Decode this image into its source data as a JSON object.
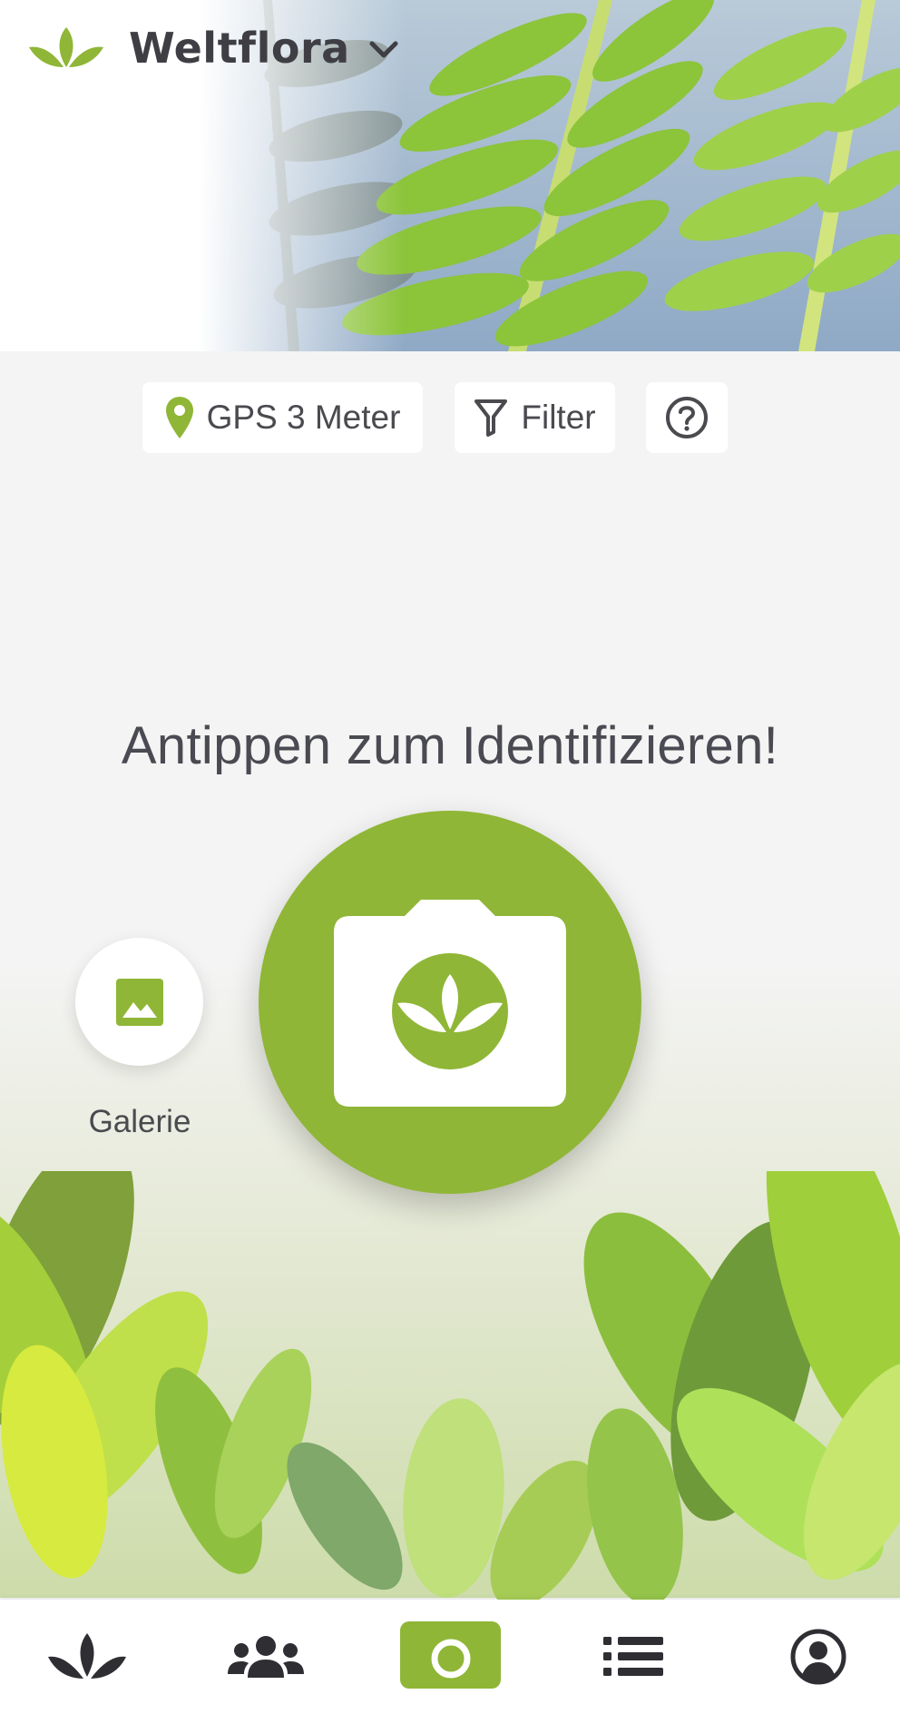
{
  "app": {
    "flora_selector": "Weltflora"
  },
  "toolbar": {
    "gps_label": "GPS 3 Meter",
    "filter_label": "Filter"
  },
  "main": {
    "prompt": "Antippen zum Identifizieren!",
    "gallery_label": "Galerie"
  },
  "icons": {
    "logo": "plant-logo-icon",
    "dropdown": "chevron-down-icon",
    "gps": "location-pin-icon",
    "filter": "filter-icon",
    "help": "question-circle-icon",
    "gallery": "image-icon",
    "camera": "camera-icon",
    "nav": [
      "plant-icon",
      "community-icon",
      "camera-icon",
      "list-icon",
      "profile-icon"
    ]
  },
  "colors": {
    "accent": "#8fb636",
    "text": "#4a4a4f",
    "nav_icon": "#2e2e33",
    "background": "#f4f4f4"
  }
}
